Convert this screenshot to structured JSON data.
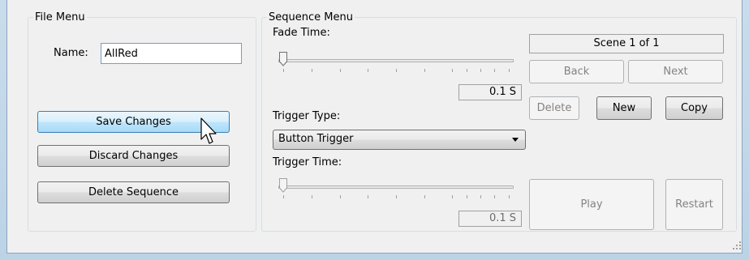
{
  "file_menu": {
    "title": "File Menu",
    "name_label": "Name:",
    "name_value": "AllRed",
    "save_label": "Save Changes",
    "discard_label": "Discard Changes",
    "delete_sequence_label": "Delete Sequence"
  },
  "sequence_menu": {
    "title": "Sequence Menu",
    "fade_time_label": "Fade Time:",
    "fade_time_value": "0.1 S",
    "trigger_type_label": "Trigger Type:",
    "trigger_type_value": "Button Trigger",
    "trigger_time_label": "Trigger Time:",
    "trigger_time_value": "0.1 S",
    "scene_text": "Scene 1 of 1",
    "back_label": "Back",
    "next_label": "Next",
    "delete_label": "Delete",
    "new_label": "New",
    "copy_label": "Copy",
    "play_label": "Play",
    "restart_label": "Restart"
  },
  "icons": {
    "cursor": "arrow-pointer-icon",
    "slider_thumb": "slider-thumb-icon",
    "dropdown": "chevron-down-icon",
    "resize_grip": "resize-grip-icon"
  }
}
